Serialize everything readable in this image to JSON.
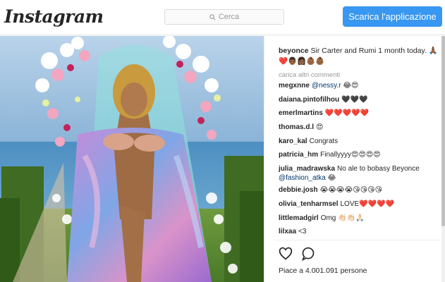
{
  "header": {
    "logo": "Instagram",
    "search_placeholder": "Cerca",
    "cta_label": "Scarica l'applicazione"
  },
  "caption": {
    "username": "beyonce",
    "text": "Sir Carter and Rumi 1 month today. 🙏🏾❤️👨🏾👩🏾👶🏾👶🏾"
  },
  "load_more": "carica altri commenti",
  "comments": [
    {
      "user": "megxnne",
      "mention": "@nessy.r",
      "text": "😂😍"
    },
    {
      "user": "daiana.pintofilhou",
      "text": "🖤🖤🖤"
    },
    {
      "user": "emerlmartins",
      "text": "❤️❤️❤️❤️❤️"
    },
    {
      "user": "thomas.d.l",
      "text": "😍"
    },
    {
      "user": "karo_kal",
      "text": "Congrats"
    },
    {
      "user": "patricia_hm",
      "text": "Finallyyyy😍😍😍😍"
    },
    {
      "user": "julia_madrawska",
      "text": "No ale to bobasy Beyonce",
      "mention": "@fashion_atka",
      "tail": "😂"
    },
    {
      "user": "debbie.josh",
      "text": "😭😭😭😭😘😘😘😘"
    },
    {
      "user": "olivia_tenharmsel",
      "text": "LOVE❤️❤️❤️❤️"
    },
    {
      "user": "littlemadgirl",
      "text": "Omg 👏🏻👏🏻🙏🏻"
    },
    {
      "user": "lilxaa",
      "text": "<3"
    }
  ],
  "likes": "Piace a 4.001.091 persone",
  "icons": [
    "heart-icon",
    "comment-icon",
    "search-icon"
  ],
  "colors": {
    "accent": "#3897f0",
    "border": "#dbdbdb",
    "muted": "#999999"
  }
}
